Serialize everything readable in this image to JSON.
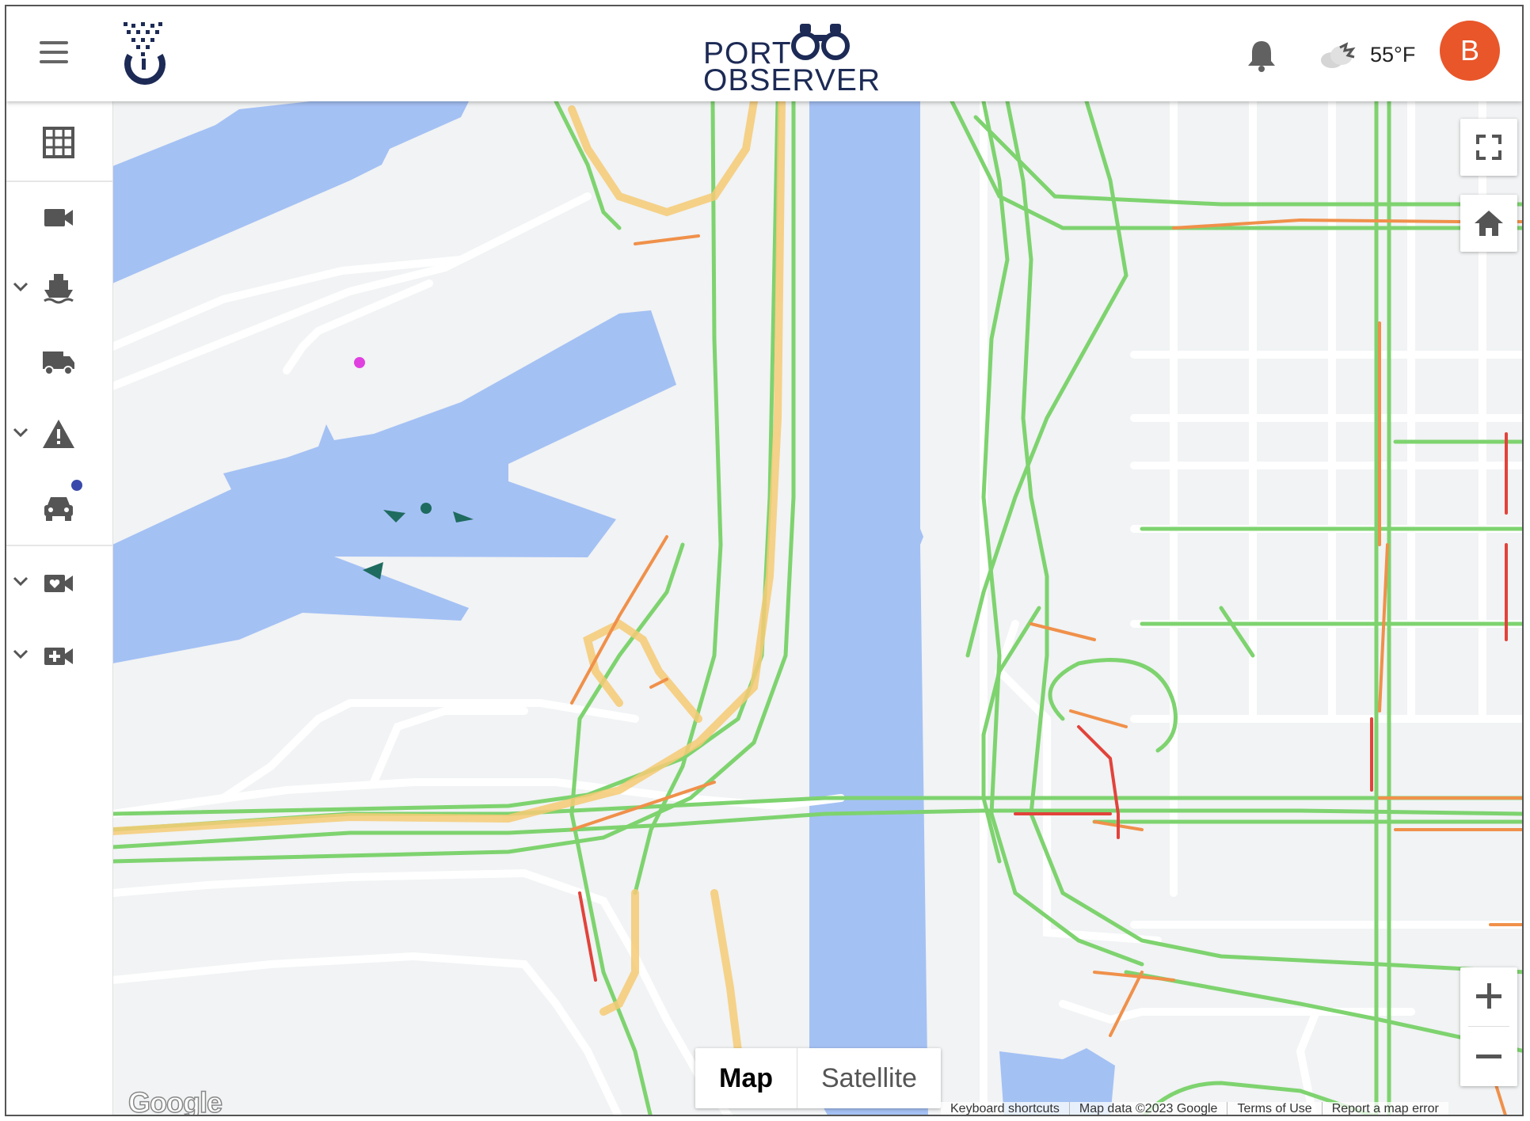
{
  "app": {
    "brand_top": "PORT",
    "brand_bottom": "OBSERVER",
    "temperature": "55°F",
    "avatar_initial": "B",
    "colors": {
      "brand_navy": "#1c2a55",
      "avatar": "#e8562a",
      "water": "#a4c1f4",
      "traffic_green": "#7ed36f",
      "traffic_orange": "#f0904a",
      "traffic_red": "#e2433b"
    }
  },
  "header": {
    "menu_icon": "hamburger-icon",
    "notification_icon": "bell-icon",
    "weather_icon": "cloud-icon"
  },
  "sidebar": {
    "items": [
      {
        "name": "grid",
        "icon": "grid-icon",
        "expandable": false
      },
      {
        "name": "camera",
        "icon": "video-camera-icon",
        "expandable": false
      },
      {
        "name": "vessels",
        "icon": "ship-icon",
        "expandable": true
      },
      {
        "name": "trucks",
        "icon": "truck-icon",
        "expandable": false
      },
      {
        "name": "alerts",
        "icon": "warning-icon",
        "expandable": true
      },
      {
        "name": "vehicles",
        "icon": "car-icon",
        "expandable": false,
        "has_notification": true
      },
      {
        "name": "favorite-cameras",
        "icon": "camera-heart-icon",
        "expandable": true
      },
      {
        "name": "add-camera",
        "icon": "camera-plus-icon",
        "expandable": true
      }
    ]
  },
  "map": {
    "map_type_options": [
      "Map",
      "Satellite"
    ],
    "selected_map_type": "Map",
    "attribution": [
      "Keyboard shortcuts",
      "Map data ©2023 Google",
      "Terms of Use",
      "Report a map error"
    ],
    "provider_logo": "Google",
    "controls": [
      "fullscreen-icon",
      "home-icon",
      "zoom-in-icon",
      "zoom-out-icon"
    ]
  }
}
